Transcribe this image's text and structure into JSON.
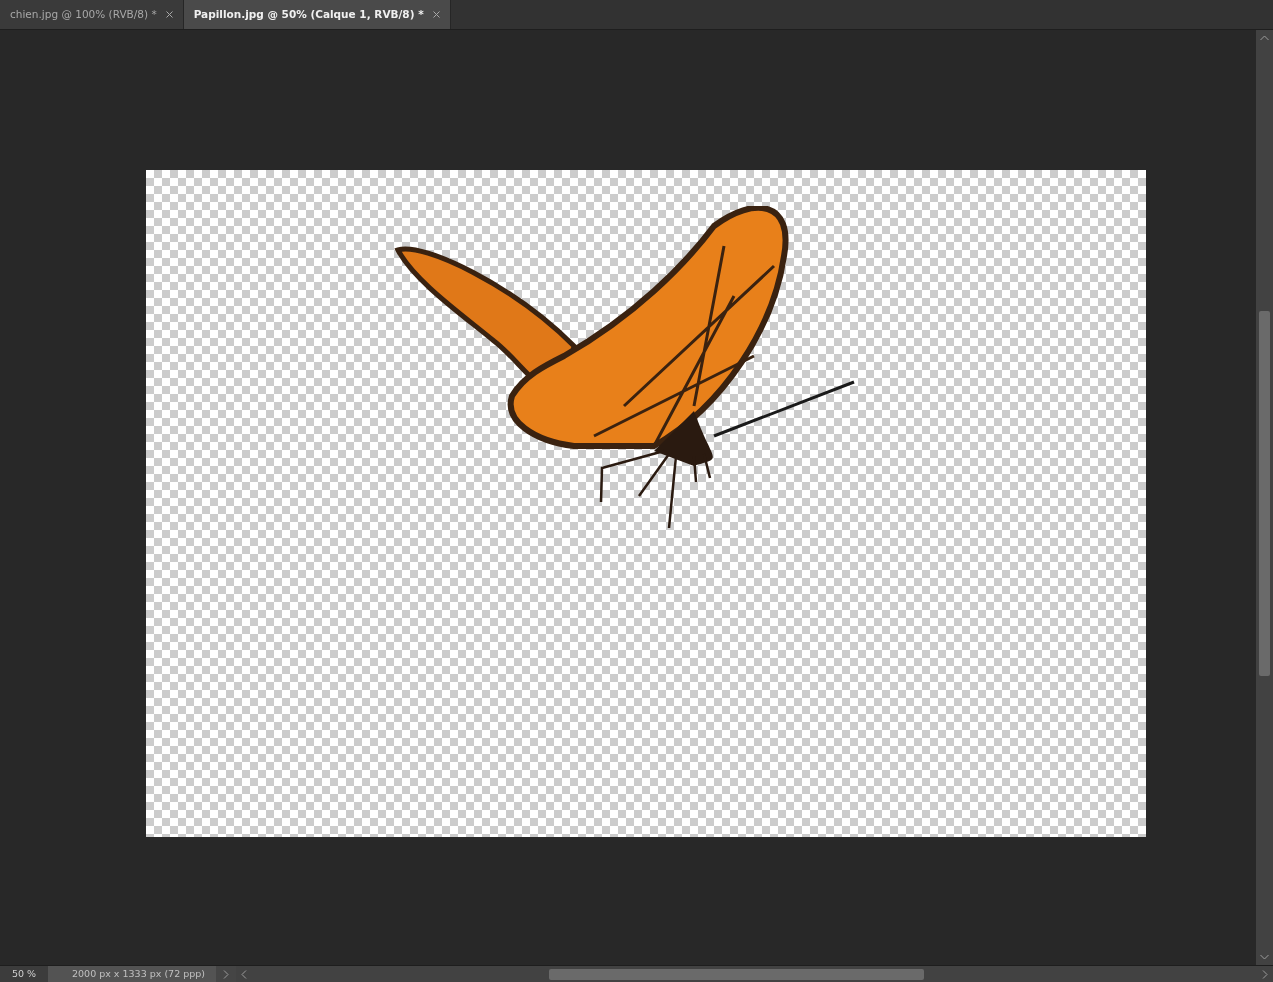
{
  "tabs": [
    {
      "label": "chien.jpg @ 100% (RVB/8) *",
      "selected": false
    },
    {
      "label": "Papillon.jpg @ 50% (Calque 1, RVB/8) *",
      "selected": true
    }
  ],
  "status_bar": {
    "zoom": "50 %",
    "document_info": "2000 px x 1333 px (72 ppp)"
  }
}
